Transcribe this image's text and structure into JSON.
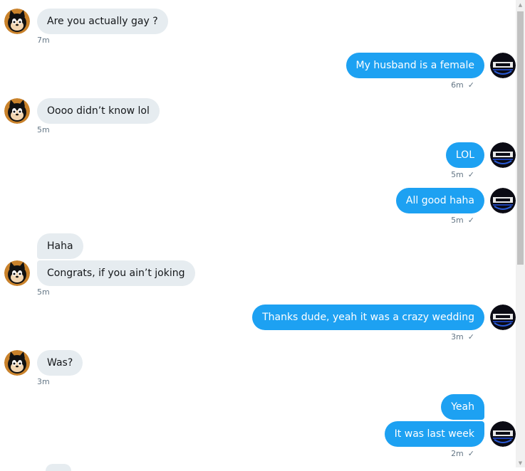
{
  "messages": [
    {
      "text": "Are you actually gay ?",
      "time": "7m"
    },
    {
      "text": "My husband is a female",
      "time": "6m"
    },
    {
      "text": "Oooo didn’t know lol",
      "time": "5m"
    },
    {
      "text": "LOL",
      "time": "5m"
    },
    {
      "text": "All good haha",
      "time": "5m"
    },
    {
      "text": "Haha"
    },
    {
      "text": "Congrats,  if you ain’t joking",
      "time": "5m"
    },
    {
      "text": "Thanks dude, yeah it was a crazy wedding",
      "time": "3m"
    },
    {
      "text": "Was?",
      "time": "3m"
    },
    {
      "text": "Yeah"
    },
    {
      "text": "It was last week",
      "time": "2m"
    }
  ],
  "read_receipt": "✓",
  "icons": {
    "contact_avatar": "cartoon-cat-avatar-icon",
    "own_avatar": "logo-avatar-icon"
  },
  "colors": {
    "outgoing_bubble": "#1da1f2",
    "incoming_bubble": "#e6ecf0",
    "meta_text": "#657786"
  }
}
